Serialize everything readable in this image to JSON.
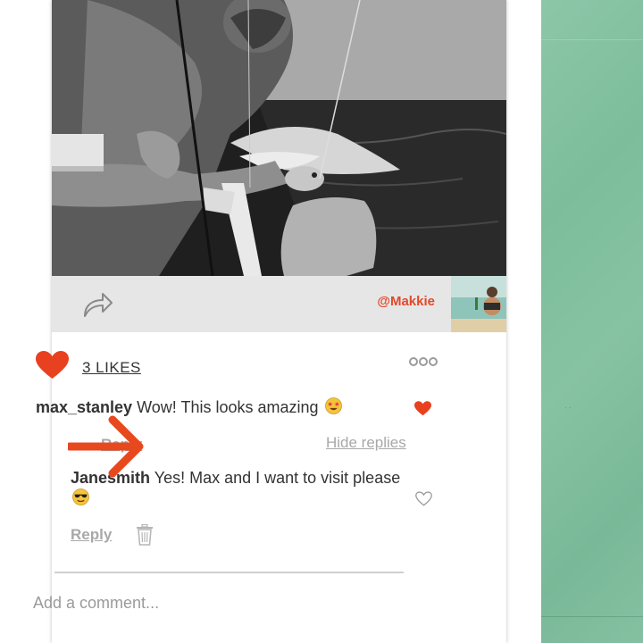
{
  "post": {
    "author_handle": "@Makkie",
    "likes_label": "3 LIKES"
  },
  "comments": [
    {
      "username": "max_stanley",
      "text": "Wow! This looks amazing",
      "emoji_icon": "star-struck-emoji",
      "liked": true,
      "reply_label": "Reply",
      "hide_replies_label": "Hide replies",
      "replies": [
        {
          "username": "Janesmith",
          "text": "Yes! Max and I want to visit please",
          "emoji_icon": "sunglasses-emoji",
          "liked": false,
          "reply_label": "Reply"
        }
      ]
    }
  ],
  "composer": {
    "placeholder": "Add a comment..."
  },
  "annotation": {
    "arrow_color": "#e8481e"
  },
  "colors": {
    "accent": "#e2492a",
    "heart": "#e8411f",
    "muted_link": "#a8a8a8",
    "side_panel": "#84c1a2"
  }
}
